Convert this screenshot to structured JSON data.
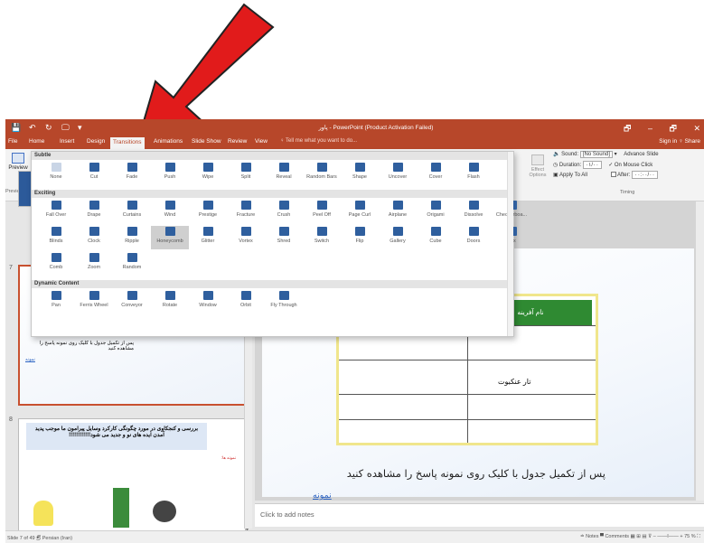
{
  "window": {
    "title": "پاور - PowerPoint (Product Activation Failed)",
    "controls": [
      "🗗",
      "–",
      "🗗",
      "✕"
    ]
  },
  "colors": {
    "accent": "#b7472a",
    "annotation_arrow": "#e11b1b",
    "link": "#2a62c2"
  },
  "quick_access": [
    "💾",
    "↶",
    "↻",
    "🖵",
    "▾"
  ],
  "tabs": [
    {
      "label": "File",
      "active": false
    },
    {
      "label": "Home",
      "active": false
    },
    {
      "label": "Insert",
      "active": false
    },
    {
      "label": "Design",
      "active": false
    },
    {
      "label": "Transitions",
      "active": true
    },
    {
      "label": "Animations",
      "active": false
    },
    {
      "label": "Slide Show",
      "active": false
    },
    {
      "label": "Review",
      "active": false
    },
    {
      "label": "View",
      "active": false
    }
  ],
  "tell_me": "♀ Tell me what you want to do...",
  "signin": "Sign in  ♀ Share",
  "ribbon": {
    "preview_label": "Preview",
    "preview_group": "Preview",
    "effect_options": "Effect Options",
    "sound_label": "Sound:",
    "sound_value": "[No Sound]",
    "duration_label": "Duration:",
    "duration_value": "۰۱/۰۰",
    "apply_all": "Apply To All",
    "advance_slide": "Advance Slide",
    "on_mouse_click": "On Mouse Click",
    "after_label": "After:",
    "after_value": "۰۰:۰۰/۰۰",
    "timing_group": "Timing"
  },
  "gallery": {
    "sections": [
      {
        "title": "Subtle",
        "items": [
          "None",
          "Cut",
          "Fade",
          "Push",
          "Wipe",
          "Split",
          "Reveal",
          "Random Bars",
          "Shape",
          "Uncover",
          "Cover",
          "Flash"
        ]
      },
      {
        "title": "Exciting",
        "items": [
          "Fall Over",
          "Drape",
          "Curtains",
          "Wind",
          "Prestige",
          "Fracture",
          "Crush",
          "Peel Off",
          "Page Curl",
          "Airplane",
          "Origami",
          "Dissolve",
          "Checkerboa...",
          "Blinds",
          "Clock",
          "Ripple",
          "Honeycomb",
          "Glitter",
          "Vortex",
          "Shred",
          "Switch",
          "Flip",
          "Gallery",
          "Cube",
          "Doors",
          "Box",
          "Comb",
          "Zoom",
          "Random"
        ]
      },
      {
        "title": "Dynamic Content",
        "items": [
          "Pan",
          "Ferris Wheel",
          "Conveyor",
          "Rotate",
          "Window",
          "Orbit",
          "Fly Through"
        ]
      }
    ],
    "selected": "Honeycomb"
  },
  "thumbnails": {
    "slide7_label": "7",
    "slide7_table_cell": "تارعنکبوت",
    "slide7_caption": "پس از تکمیل جدول با کلیک روی نمونه پاسخ را مشاهده کنید",
    "slide7_link": "نمونه",
    "slide8_label": "8",
    "slide8_title": "بررسی و کنجکاوی در مورد چگونگی کارکرد وسایل پیرامون ما موجب پدید آمدن ایده های نو و جدید می شود!!!!!!!!!!!!",
    "slide8_sub": "نمونه ها:"
  },
  "slide": {
    "header_cell": "نام آفرینه",
    "table_cell": "تار عنکبوت",
    "instruction": "پس از تکمیل جدول با کلیک روی نمونه پاسخ را مشاهده کنید",
    "link": "نمونه"
  },
  "notes_placeholder": "Click to add notes",
  "status": {
    "left": "Slide 7 of 49   🗊   Persian (Iran)",
    "right": "≐ Notes   ▀ Comments   ▦  ⊞  ▤  ⊽  –  ——I——  +  75 %  ⛶"
  }
}
